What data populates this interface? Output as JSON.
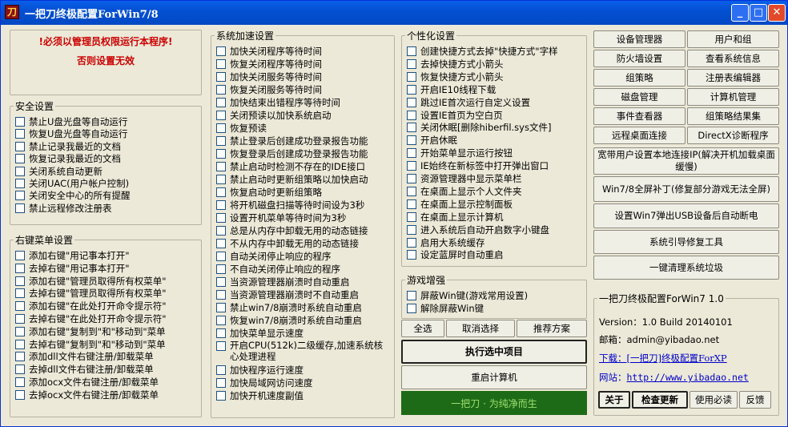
{
  "window": {
    "title": "一把刀终极配置ForWin7/8",
    "icon_glyph": "刀",
    "min": "_",
    "max": "□",
    "close": "✕"
  },
  "warning": {
    "line1": "!必须以管理员权限运行本程序!",
    "line2": "否则设置无效"
  },
  "security": {
    "legend": "安全设置",
    "items": [
      "禁止U盘光盘等自动运行",
      "恢复U盘光盘等自动运行",
      "禁止记录我最近的文档",
      "恢复记录我最近的文档",
      "关闭系统自动更新",
      "关闭UAC(用户帐户控制)",
      "关闭安全中心的所有提醒",
      "禁止远程修改注册表"
    ]
  },
  "context_menu": {
    "legend": "右键菜单设置",
    "items": [
      "添加右键\"用记事本打开\"",
      "去掉右键\"用记事本打开\"",
      "添加右键\"管理员取得所有权菜单\"",
      "去掉右键\"管理员取得所有权菜单\"",
      "添加右键\"在此处打开命令提示符\"",
      "去掉右键\"在此处打开命令提示符\"",
      "添加右键\"复制到\"和\"移动到\"菜单",
      "去掉右键\"复制到\"和\"移动到\"菜单",
      "添加dll文件右键注册/卸载菜单",
      "去掉dll文件右键注册/卸载菜单",
      "添加ocx文件右键注册/卸载菜单",
      "去掉ocx文件右键注册/卸载菜单"
    ]
  },
  "speedup": {
    "legend": "系统加速设置",
    "items": [
      "加快关闭程序等待时间",
      "恢复关闭程序等待时间",
      "加快关闭服务等待时间",
      "恢复关闭服务等待时间",
      "加快结束出错程序等待时间",
      "关闭预读以加快系统启动",
      "恢复预读",
      "禁止登录后创建成功登录报告功能",
      "恢复登录后创建成功登录报告功能",
      "禁止启动时检测不存在的IDE接口",
      "禁止启动时更新组策略以加快启动",
      "恢复启动时更新组策略",
      "将开机磁盘扫描等待时间设为3秒",
      "设置开机菜单等待时间为3秒",
      "总是从内存中卸载无用的动态链接",
      "不从内存中卸载无用的动态链接",
      "自动关闭停止响应的程序",
      "不自动关闭停止响应的程序",
      "当资源管理器崩溃时自动重启",
      "当资源管理器崩溃时不自动重启",
      "禁止win7/8崩溃时系统自动重启",
      "恢复win7/8崩溃时系统自动重启",
      "加快菜单显示速度",
      "开启CPU(512k)二级缓存,加速系统核心处理进程",
      "加快程序运行速度",
      "加快局域网访问速度",
      "加快开机速度副值"
    ]
  },
  "personal": {
    "legend": "个性化设置",
    "items": [
      "创建快捷方式去掉\"快捷方式\"字样",
      "去掉快捷方式小箭头",
      "恢复快捷方式小箭头",
      "开启IE10线程下载",
      "跳过IE首次运行自定义设置",
      "设置IE首页为空白页",
      "关闭休眠[删除hiberfil.sys文件]",
      "开启休眠",
      "开始菜单显示运行按钮",
      "IE始终在新标签中打开弹出窗口",
      "资源管理器中显示菜单栏",
      "在桌面上显示个人文件夹",
      "在桌面上显示控制面板",
      "在桌面上显示计算机",
      "进入系统后自动开启数字小键盘",
      "启用大系统缓存",
      "设定蓝屏时自动重启"
    ]
  },
  "game": {
    "legend": "游戏增强",
    "items": [
      "屏蔽Win键(游戏常用设置)",
      "解除屏蔽Win键"
    ]
  },
  "actions": {
    "select_all": "全选",
    "deselect": "取消选择",
    "recommend": "推荐方案",
    "execute": "执行选中项目",
    "restart": "重启计算机"
  },
  "slogan": "一把刀 · 为纯净而生",
  "tools": [
    "设备管理器",
    "用户和组",
    "防火墙设置",
    "查看系统信息",
    "组策略",
    "注册表编辑器",
    "磁盘管理",
    "计算机管理",
    "事件查看器",
    "组策略结果集",
    "远程桌面连接",
    "DirectX诊断程序"
  ],
  "wide_tools": [
    "宽带用户设置本地连接IP(解决开机加载桌面缓慢)",
    "Win7/8全屏补丁(修复部分游戏无法全屏)",
    "设置Win7弹出USB设备后自动断电",
    "系统引导修复工具",
    "一键清理系统垃圾"
  ],
  "info": {
    "legend": "一把刀终极配置ForWin7 1.0",
    "version": "Version：1.0   Build 20140101",
    "email": "邮箱：admin@yibadao.net",
    "download": "下载：[一把刀]终极配置ForXP",
    "site_label": "网站：",
    "site_url": "http://www.yibadao.net",
    "about": "关于",
    "update": "检查更新",
    "must_read": "使用必读",
    "feedback": "反馈"
  },
  "colors": {
    "title_bar": "#0450d3",
    "warning": "#cc0000",
    "slogan_bg": "#1e6b17",
    "slogan_fg": "#9ee070",
    "link": "#0000c8"
  }
}
